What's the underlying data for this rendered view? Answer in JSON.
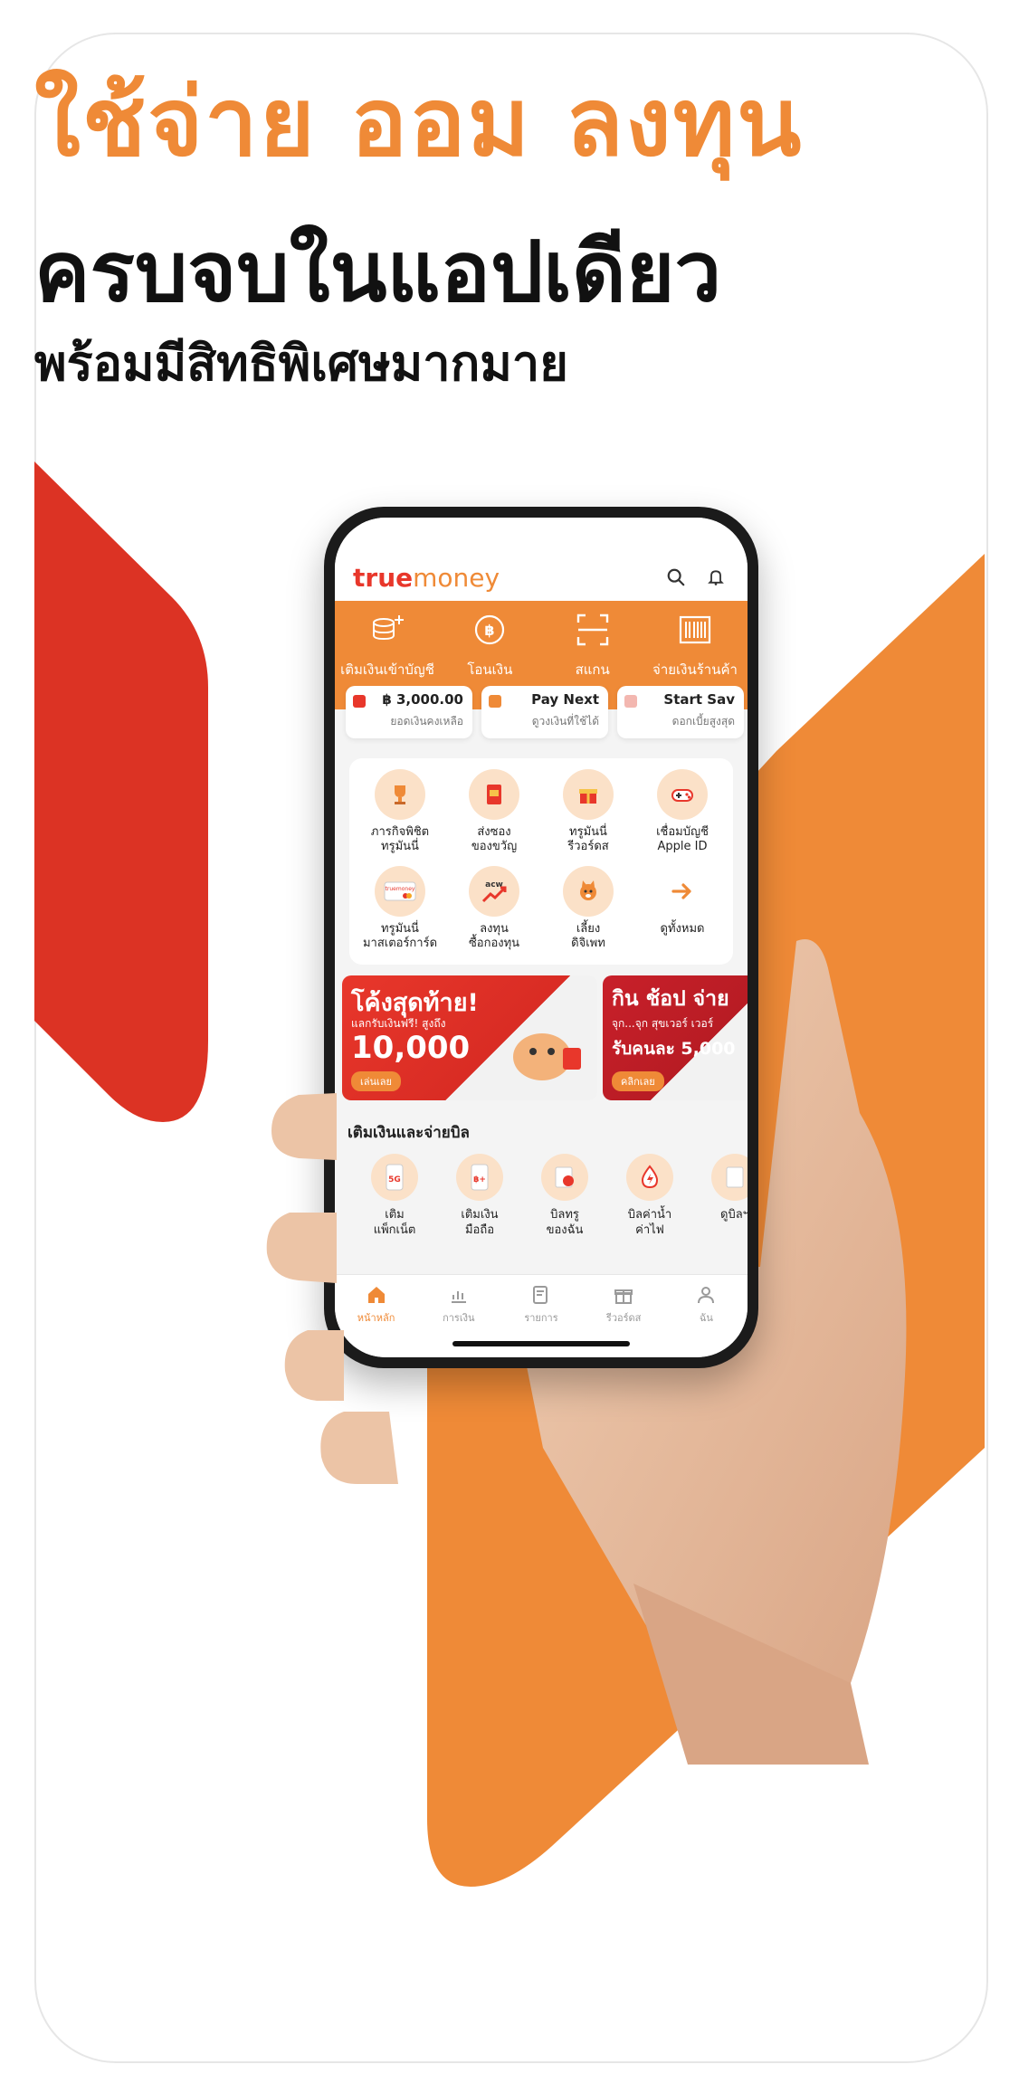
{
  "headline": {
    "words": [
      "ใช้จ่าย",
      "ออม",
      "ลงทุน"
    ],
    "line2": "ครบจบในแอปเดียว",
    "line3": "พร้อมมีสิทธิพิเศษมากมาย"
  },
  "colors": {
    "orange": "#ef8a37",
    "red": "#e8372b"
  },
  "app": {
    "logo_true": "true",
    "logo_money": "money",
    "top_icons": [
      "search-icon",
      "bell-icon"
    ],
    "quick_actions": [
      {
        "label": "เติมเงินเข้าบัญชี",
        "icon": "coin-plus-icon"
      },
      {
        "label": "โอนเงิน",
        "icon": "transfer-icon"
      },
      {
        "label": "สแกน",
        "icon": "scan-icon"
      },
      {
        "label": "จ่ายเงินร้านค้า",
        "icon": "barcode-icon"
      }
    ],
    "wallet_cards": [
      {
        "value": "฿ 3,000.00",
        "sub": "ยอดเงินคงเหลือ"
      },
      {
        "value": "Pay Next",
        "sub": "ดูวงเงินที่ใช้ได้"
      },
      {
        "value": "Start Sav",
        "sub": "ดอกเบี้ยสูงสุด"
      }
    ],
    "menu": [
      {
        "label": "ภารกิจพิชิต\nทรูมันนี่",
        "icon": "trophy-icon"
      },
      {
        "label": "ส่งซอง\nของขวัญ",
        "icon": "envelope-icon"
      },
      {
        "label": "ทรูมันนี่\nรีวอร์ดส",
        "icon": "gift-icon"
      },
      {
        "label": "เชื่อมบัญชี\nApple ID",
        "icon": "gamepad-icon"
      },
      {
        "label": "ทรูมันนี่\nมาสเตอร์การ์ด",
        "icon": "card-icon",
        "card_text": "truemoney"
      },
      {
        "label": "ลงทุน\nซื้อกองทุน",
        "icon": "chart-up-icon",
        "brand": "acw"
      },
      {
        "label": "เลี้ยง\nดิจิเพท",
        "icon": "pet-icon"
      },
      {
        "label": "ดูทั้งหมด",
        "icon": "arrow-right-icon"
      }
    ],
    "banners": [
      {
        "title": "โค้งสุดท้าย!",
        "sub": "แลกรับเงินฟรี! สูงถึง",
        "amount": "10,000",
        "cta": "เล่นเลย"
      },
      {
        "title": "กิน ช้อป จ่าย",
        "sub": "จุก...จุก สุขเวอร์ เวอร์",
        "amount": "รับคนละ 5,000",
        "cta": "คลิกเลย"
      }
    ],
    "bills_title": "เติมเงินและจ่ายบิล",
    "bills": [
      {
        "label": "เติม\nแพ็กเน็ต",
        "icon": "sim-5g-icon",
        "badge": "5G"
      },
      {
        "label": "เติมเงิน\nมือถือ",
        "icon": "sim-topup-icon",
        "badge": "฿+"
      },
      {
        "label": "บิลทรู\nของฉัน",
        "icon": "bill-true-icon"
      },
      {
        "label": "บิลค่าน้ำ\nค่าไฟ",
        "icon": "utility-icon"
      },
      {
        "label": "ดูบิลฯ",
        "icon": "bill-more-icon"
      }
    ],
    "nav": [
      {
        "label": "หน้าหลัก",
        "icon": "home-icon",
        "active": true
      },
      {
        "label": "การเงิน",
        "icon": "finance-icon"
      },
      {
        "label": "รายการ",
        "icon": "transactions-icon"
      },
      {
        "label": "รีวอร์ดส",
        "icon": "rewards-icon"
      },
      {
        "label": "ฉัน",
        "icon": "profile-icon"
      }
    ]
  }
}
